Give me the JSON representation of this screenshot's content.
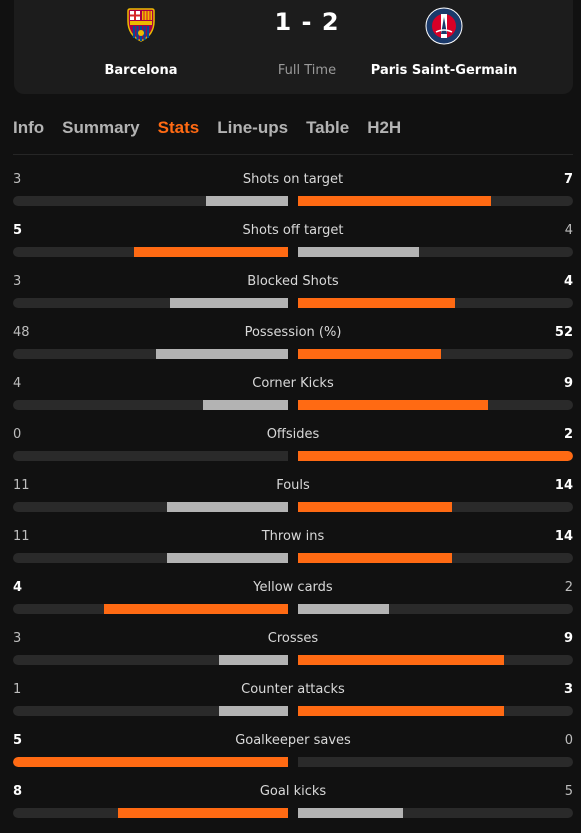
{
  "match": {
    "home_team": "Barcelona",
    "away_team": "Paris Saint-Germain",
    "score": "1 - 2",
    "status": "Full Time"
  },
  "tabs": [
    {
      "label": "Info",
      "active": false
    },
    {
      "label": "Summary",
      "active": false
    },
    {
      "label": "Stats",
      "active": true
    },
    {
      "label": "Line-ups",
      "active": false
    },
    {
      "label": "Table",
      "active": false
    },
    {
      "label": "H2H",
      "active": false
    }
  ],
  "colors": {
    "accent": "#ff6a13",
    "bar_neutral": "#b3b3b3",
    "track": "#2a2a2a",
    "background": "#111111"
  },
  "stats": [
    {
      "label": "Shots on target",
      "home": "3",
      "away": "7",
      "home_ratio": 0.3,
      "away_ratio": 0.7,
      "leader": "away"
    },
    {
      "label": "Shots off target",
      "home": "5",
      "away": "4",
      "home_ratio": 0.56,
      "away_ratio": 0.44,
      "leader": "home"
    },
    {
      "label": "Blocked Shots",
      "home": "3",
      "away": "4",
      "home_ratio": 0.43,
      "away_ratio": 0.57,
      "leader": "away"
    },
    {
      "label": "Possession (%)",
      "home": "48",
      "away": "52",
      "home_ratio": 0.48,
      "away_ratio": 0.52,
      "leader": "away"
    },
    {
      "label": "Corner Kicks",
      "home": "4",
      "away": "9",
      "home_ratio": 0.31,
      "away_ratio": 0.69,
      "leader": "away"
    },
    {
      "label": "Offsides",
      "home": "0",
      "away": "2",
      "home_ratio": 0.0,
      "away_ratio": 1.0,
      "leader": "away"
    },
    {
      "label": "Fouls",
      "home": "11",
      "away": "14",
      "home_ratio": 0.44,
      "away_ratio": 0.56,
      "leader": "away"
    },
    {
      "label": "Throw ins",
      "home": "11",
      "away": "14",
      "home_ratio": 0.44,
      "away_ratio": 0.56,
      "leader": "away"
    },
    {
      "label": "Yellow cards",
      "home": "4",
      "away": "2",
      "home_ratio": 0.67,
      "away_ratio": 0.33,
      "leader": "home"
    },
    {
      "label": "Crosses",
      "home": "3",
      "away": "9",
      "home_ratio": 0.25,
      "away_ratio": 0.75,
      "leader": "away"
    },
    {
      "label": "Counter attacks",
      "home": "1",
      "away": "3",
      "home_ratio": 0.25,
      "away_ratio": 0.75,
      "leader": "away"
    },
    {
      "label": "Goalkeeper saves",
      "home": "5",
      "away": "0",
      "home_ratio": 1.0,
      "away_ratio": 0.0,
      "leader": "home"
    },
    {
      "label": "Goal kicks",
      "home": "8",
      "away": "5",
      "home_ratio": 0.62,
      "away_ratio": 0.38,
      "leader": "home"
    }
  ]
}
